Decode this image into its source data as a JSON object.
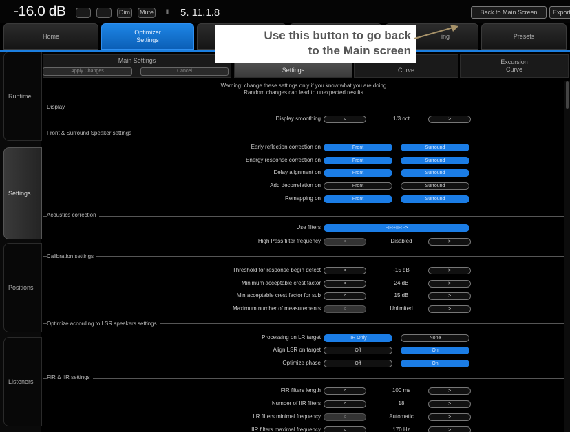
{
  "status": {
    "volume": "-16.0 dB",
    "buttons": [
      "",
      "",
      "Dim",
      "Mute",
      "Ⅱ"
    ],
    "format": "5. 11.1.8",
    "back_main": "Back to Main Screen",
    "export": "Export"
  },
  "main_tabs": [
    "Home",
    "Optimizer Settings",
    "",
    "",
    "Presets"
  ],
  "main_tab_partial": "ing",
  "callout": {
    "line1": "Use this button to go back",
    "line2": "to the Main screen"
  },
  "sidebar": [
    "Runtime",
    "Settings",
    "Positions",
    "Listeners"
  ],
  "subtabs": {
    "main_settings": "Main Settings",
    "apply_changes": "Apply Changes",
    "cancel": "Cancel",
    "settings": "Settings",
    "target_curve": "Curve",
    "excursion": "Excursion Curve"
  },
  "warning": {
    "line1": "Warning: change these settings only if you know what you are doing",
    "line2": "Random changes can lead to unexpected results"
  },
  "sections": {
    "display": "Display",
    "speakers": "Front & Surround Speaker settings",
    "acoustics": "Acoustics correction",
    "calibration": "Calibration settings",
    "optimize": "Optimize according to LSR speakers settings",
    "fir": "FIR & IIR settings"
  },
  "rows": {
    "display_smoothing": "Display smoothing",
    "display_smoothing_value": "1/3 oct",
    "early_reflection": "Early reflection correction on",
    "energy_response": "Energy response correction on",
    "delay_alignment": "Delay alignment on",
    "add_decorrelation": "Add decorrelation on",
    "remapping": "Remapping on",
    "front": "Front",
    "surround": "Surround",
    "use_filters": "Use filters",
    "use_filters_value": "FIR+IIR ->",
    "high_pass": "High Pass filter frequency",
    "high_pass_value": "Disabled",
    "threshold": "Threshold for response begin detect",
    "threshold_value": "-15 dB",
    "min_crest": "Minimum acceptable crest factor",
    "min_crest_value": "24 dB",
    "min_crest_sub": "Min acceptable crest factor for sub",
    "min_crest_sub_value": "15 dB",
    "max_measurements": "Maximum number of measurements",
    "max_measurements_value": "Unlimited",
    "processing_target": "Processing on LR target",
    "ir_only": "IIR Only",
    "none": "None",
    "align_lsr": "Align LSR on target",
    "optimize_phase": "Optimize phase",
    "off": "Off",
    "on": "On",
    "fir_length": "FIR filters length",
    "fir_length_value": "100 ms",
    "num_iir": "Number of IIR filters",
    "num_iir_value": "18",
    "iir_min_freq": "IIR filters minimal frequency",
    "iir_min_freq_value": "Automatic",
    "iir_max_freq": "IIR filters maximal frequency",
    "iir_max_freq_value": "170 Hz"
  },
  "arrows": {
    "left": "<",
    "right": ">"
  },
  "colors": {
    "accent": "#1b7de6",
    "background": "#000000",
    "callout": "#ffffff"
  }
}
